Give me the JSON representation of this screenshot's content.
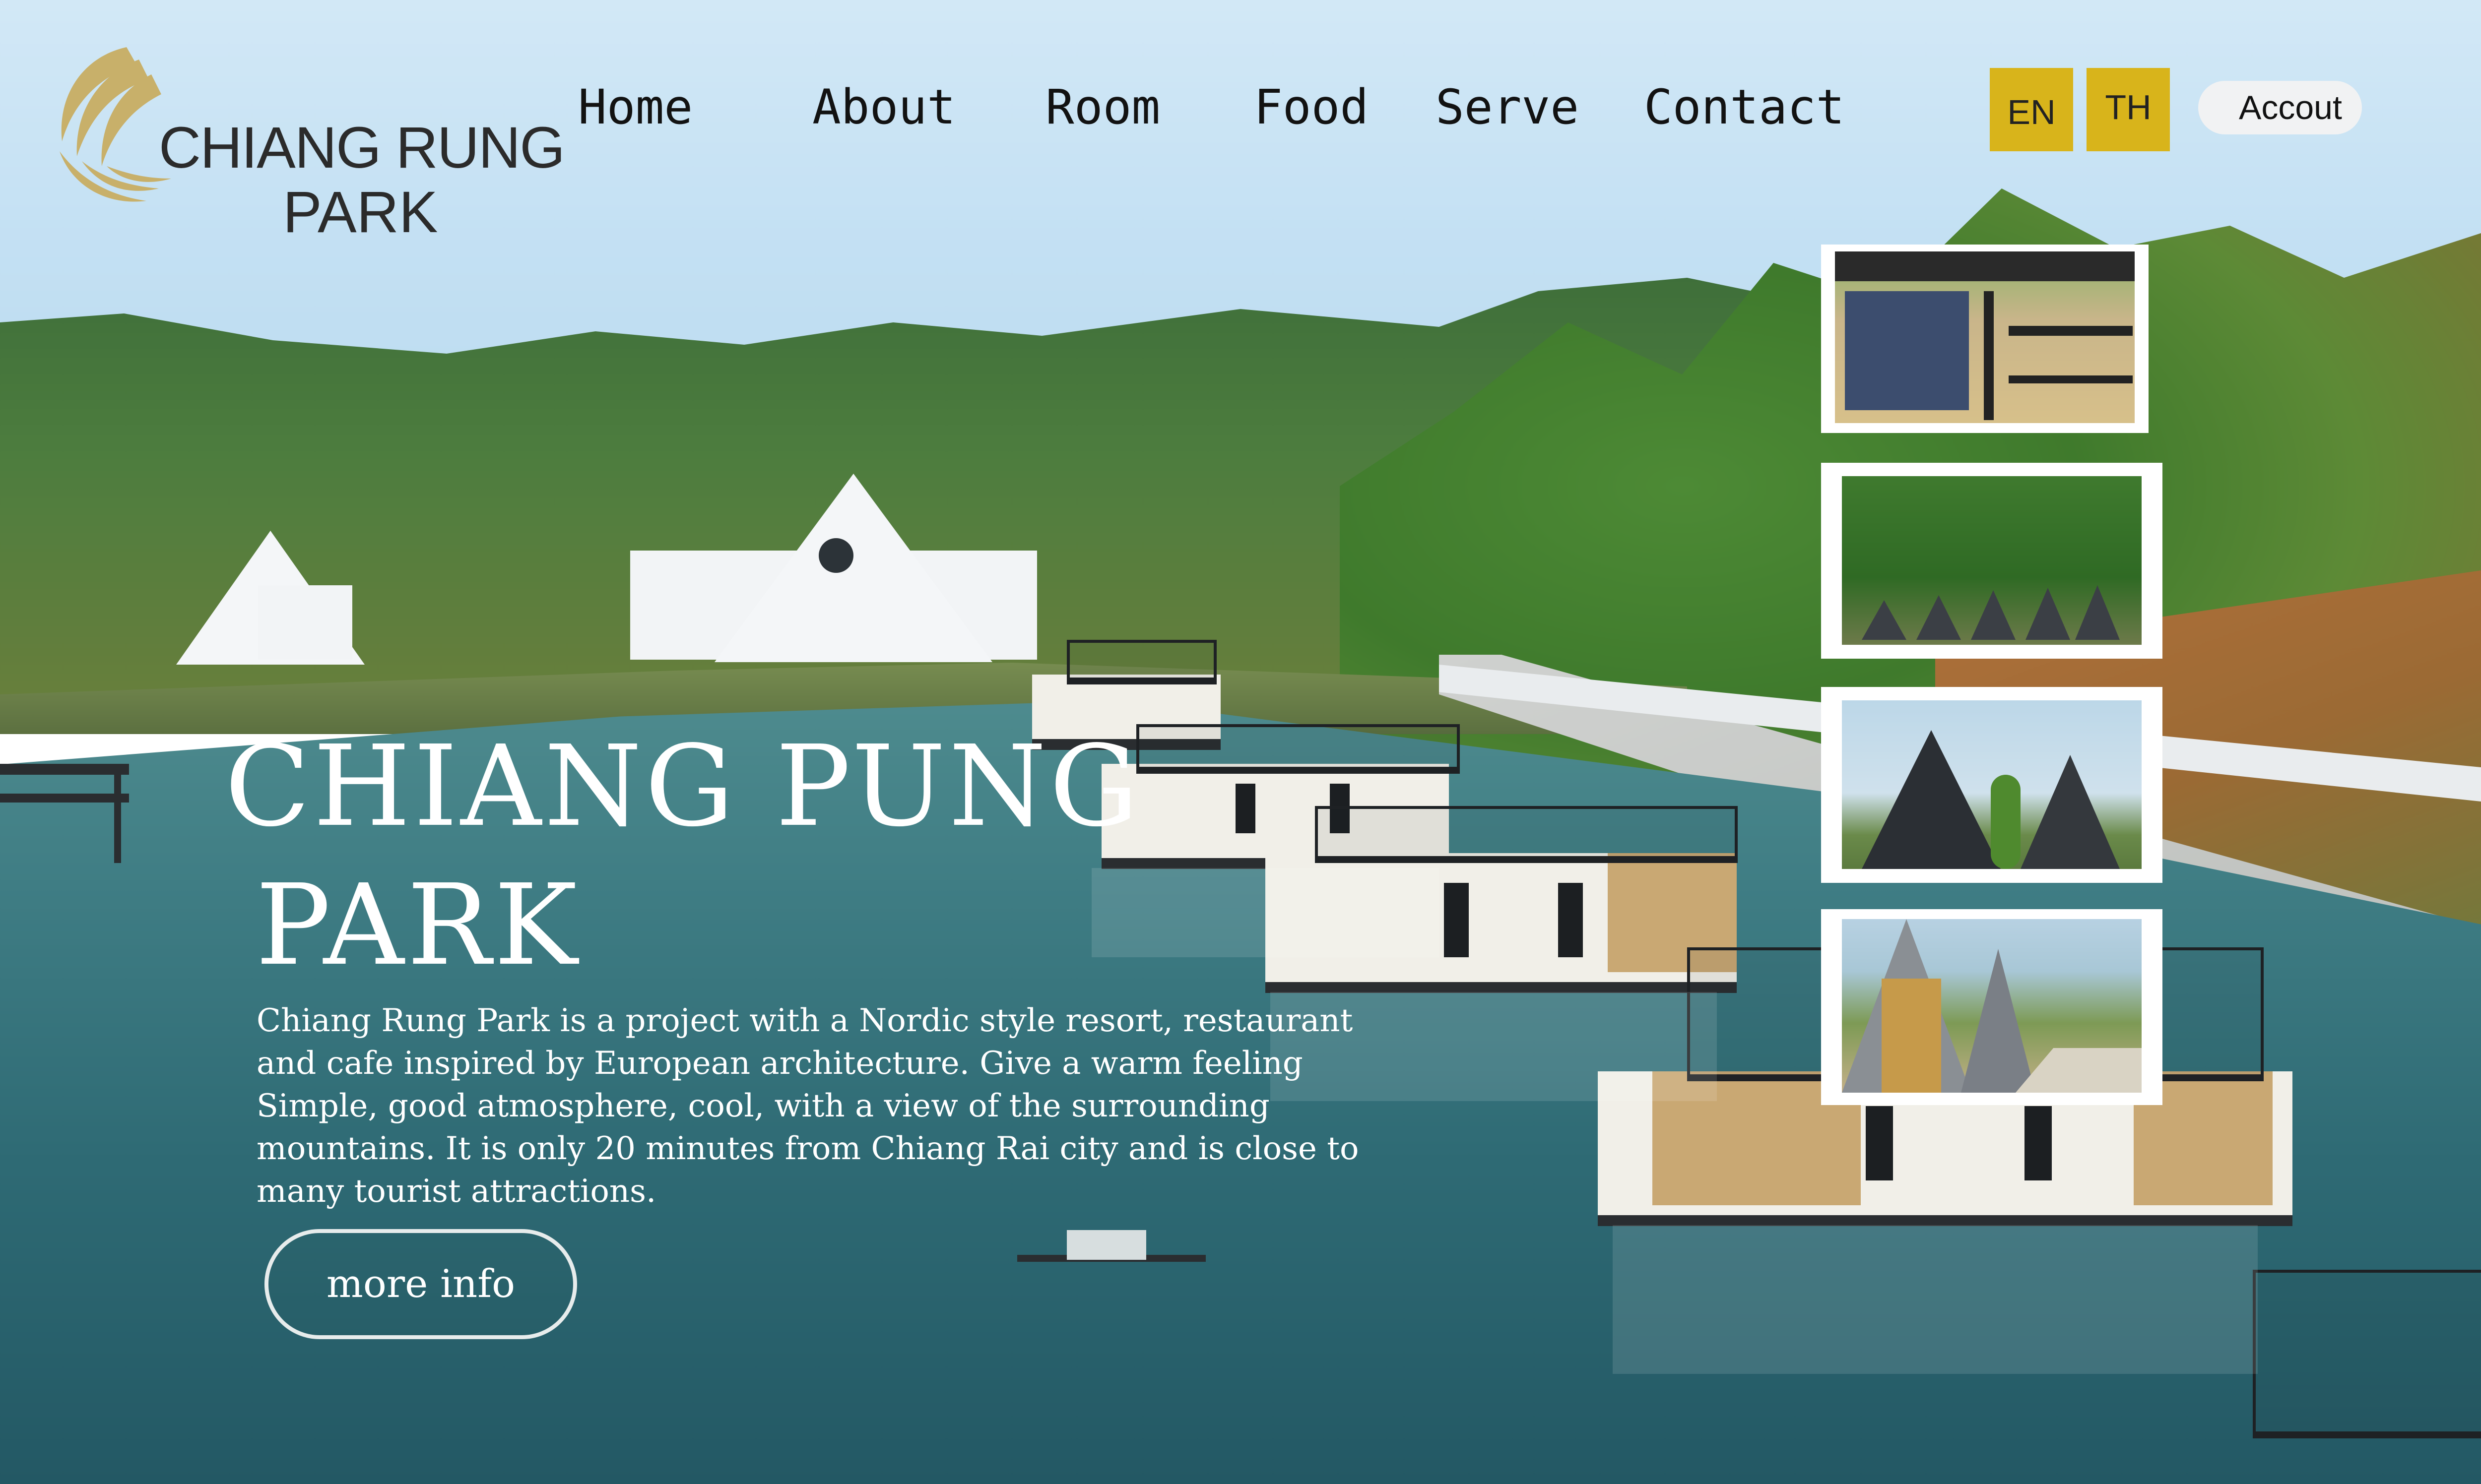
{
  "logo": {
    "line1": "CHIANG RUNG",
    "line2": "PARK"
  },
  "nav": {
    "items": [
      "Home",
      "About",
      "Room",
      "Food",
      "Serve",
      "Contact"
    ]
  },
  "languages": [
    "EN",
    "TH"
  ],
  "account": {
    "label": "Accout"
  },
  "hero": {
    "title_line1": "CHIANG PUNG",
    "title_line2": "PARK",
    "description": "Chiang Rung Park is a project with a Nordic style resort, restaurant and cafe inspired by European architecture. Give a warm feeling Simple, good atmosphere, cool, with a view of the surrounding mountains. It is only 20 minutes from Chiang Rai city and is close to many tourist attractions.",
    "cta": "more info"
  },
  "gallery": {
    "thumbnails": [
      "houseboat-room",
      "forest-cabins",
      "a-frame-cabins",
      "cabin-garden"
    ]
  },
  "colors": {
    "lang_button": "#d8b41b",
    "logo_gold": "#c8b06a",
    "logo_text": "#2b2b2b",
    "nav_text": "#121212",
    "hero_text": "#ffffff"
  }
}
